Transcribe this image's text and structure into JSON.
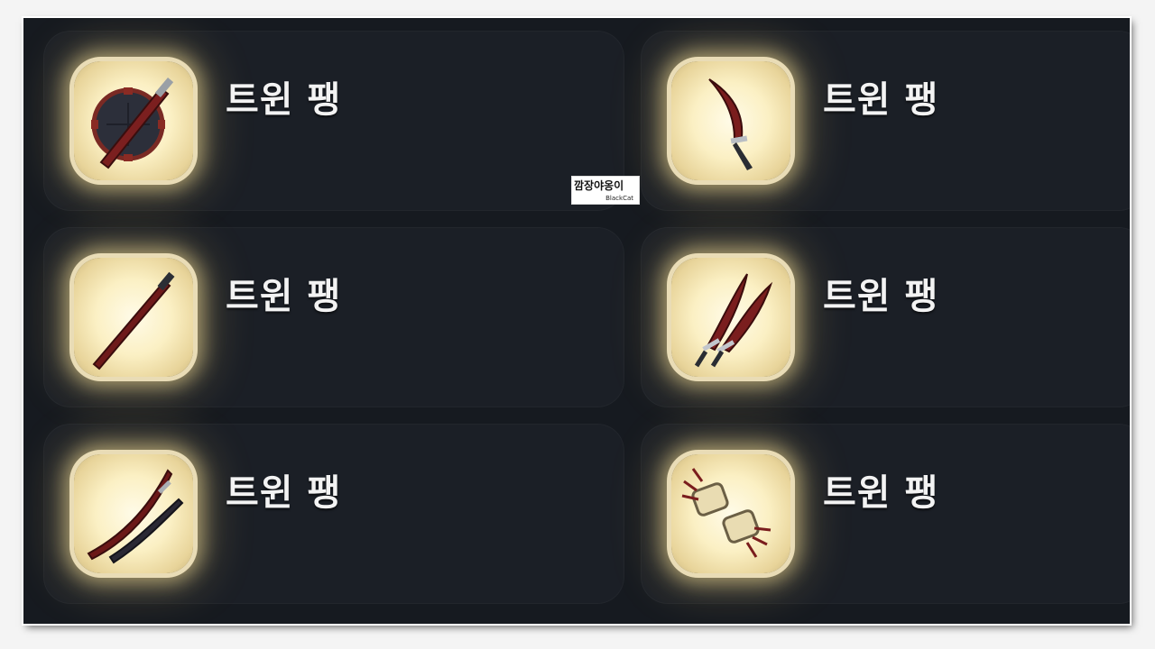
{
  "items": [
    {
      "title": "트윈 팽",
      "icon": "sword-and-shield-icon"
    },
    {
      "title": "트윈 팽",
      "icon": "curved-dagger-icon"
    },
    {
      "title": "트윈 팽",
      "icon": "long-sword-icon"
    },
    {
      "title": "트윈 팽",
      "icon": "twin-sabers-icon"
    },
    {
      "title": "트윈 팽",
      "icon": "katana-and-sheath-icon"
    },
    {
      "title": "트윈 팽",
      "icon": "spiked-gauntlets-icon"
    }
  ],
  "watermark": {
    "text": "깜장야옹이",
    "sub": "BlackCat"
  },
  "colors": {
    "background": "#161a20",
    "card": "#1b1f26",
    "icon_frame": "#e9dcb6",
    "weapon": "#6e1e1e"
  }
}
